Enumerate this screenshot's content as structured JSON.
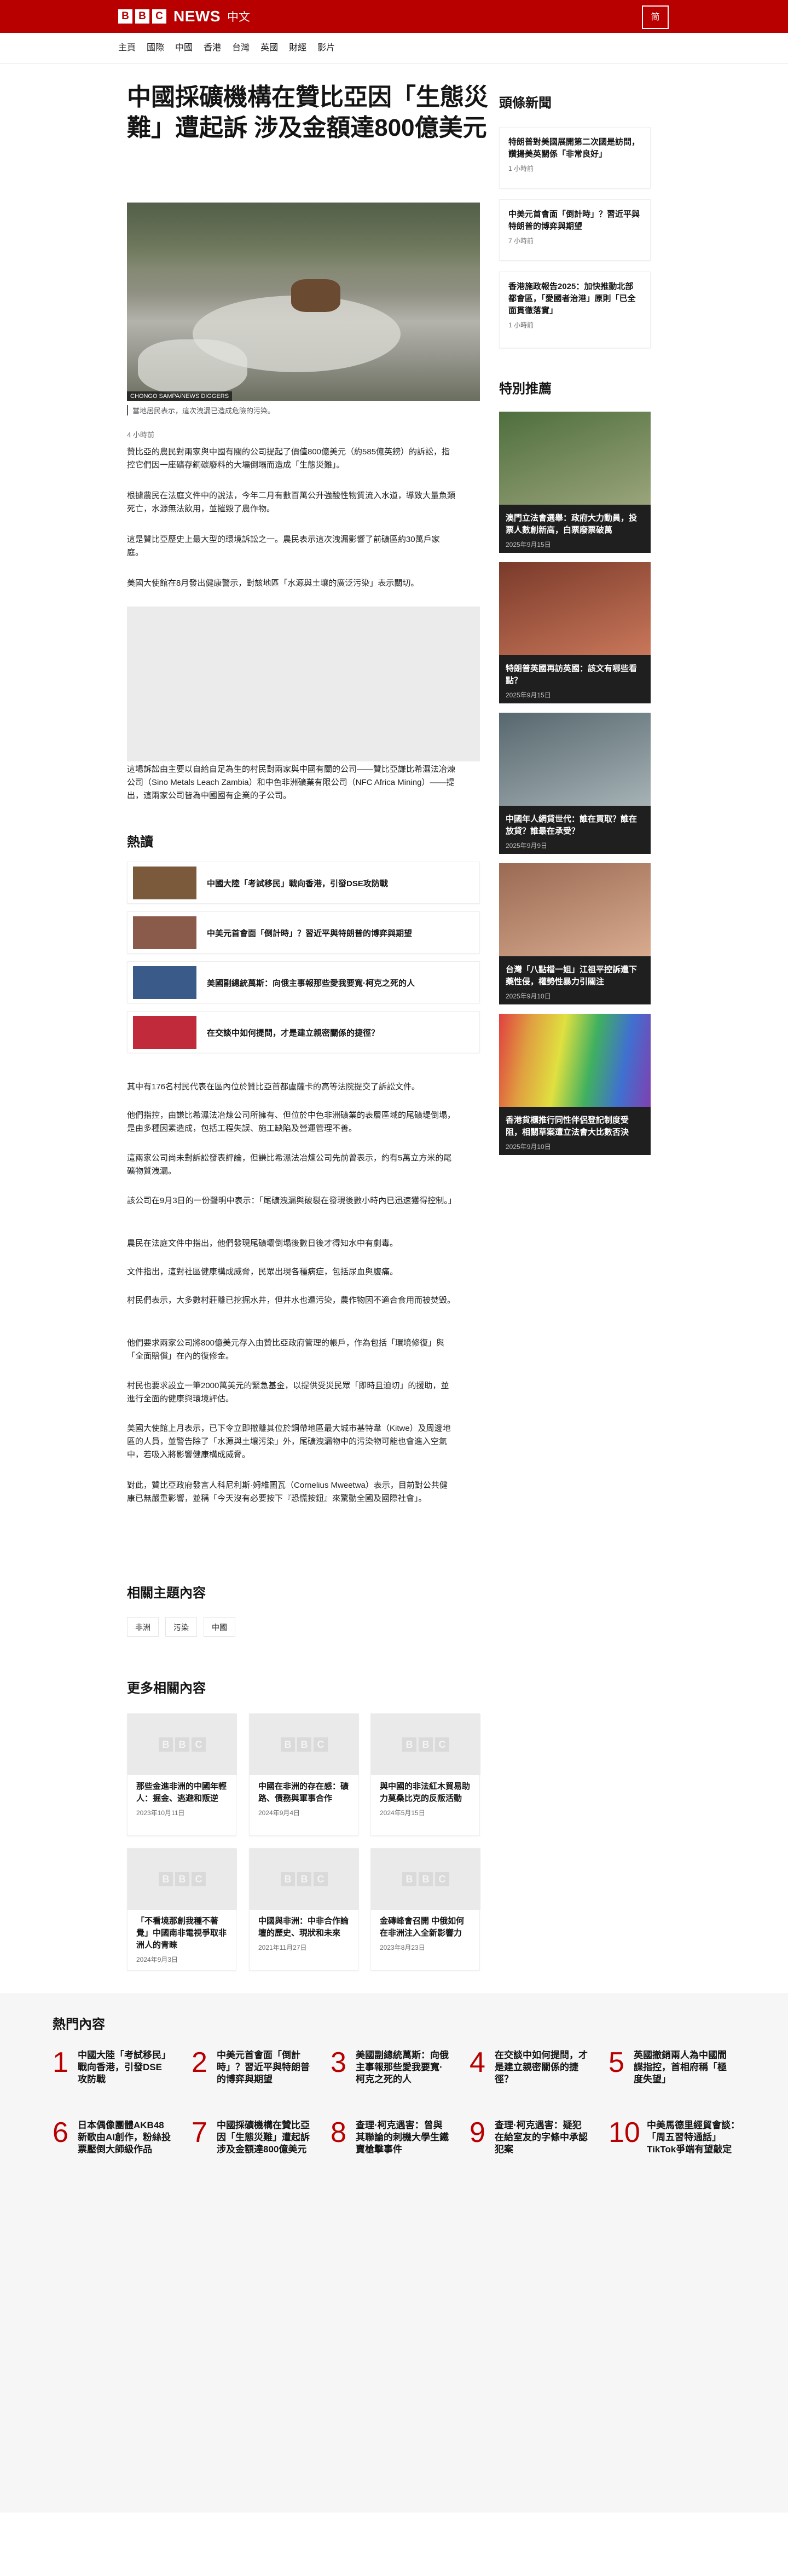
{
  "header": {
    "logo_letters": [
      "B",
      "B",
      "C"
    ],
    "brand": "NEWS",
    "language": "中文",
    "menu_label": "简"
  },
  "nav": [
    "主頁",
    "國際",
    "中國",
    "香港",
    "台灣",
    "英國",
    "財經",
    "影片"
  ],
  "article": {
    "headline": "中國採礦機構在贊比亞因「生態災難」遭起訴 涉及金額達800億美元",
    "image_credit": "CHONGO SAMPA/NEWS DIGGERS",
    "caption": "當地居民表示，這次洩漏已造成危險的污染。",
    "time_ago": "4 小時前",
    "paragraphs": [
      "贊比亞的農民對兩家與中國有關的公司提起了價值800億美元（約585億英鎊）的訴訟，指控它們因一座礦存銅碳廢料的大壩倒塌而造成「生態災難」。",
      "根據農民在法庭文件中的說法，今年二月有數百萬公升強酸性物質流入水道，導致大量魚類死亡，水源無法飲用，並摧毀了農作物。",
      "這是贊比亞歷史上最大型的環境訴訟之一。農民表示這次洩漏影響了前礦區約30萬戶家庭。",
      "美國大使館在8月發出健康警示，對該地區「水源與土壤的廣泛污染」表示關切。",
      "這場訴訟由主要以自給自足為生的村民對兩家與中國有關的公司——贊比亞謙比希濕法冶煉公司（Sino Metals Leach Zambia）和中色非洲礦業有限公司（NFC Africa Mining）——提出，這兩家公司皆為中國國有企業的子公司。"
    ],
    "more_paragraphs": [
      "其中有176名村民代表在區內位於贊比亞首都盧薩卡的高等法院提交了訴訟文件。",
      "他們指控，由謙比希濕法冶煉公司所擁有、但位於中色非洲礦業的表層區域的尾礦堤倒塌，是由多種因素造成，包括工程失誤、施工缺陷及營運管理不善。",
      "這兩家公司尚未對訴訟發表評論，但謙比希濕法冶煉公司先前曾表示，約有5萬立方米的尾礦物質洩漏。",
      "該公司在9月3日的一份聲明中表示：「尾礦洩漏與破裂在發現後數小時內已迅速獲得控制。」",
      "農民在法庭文件中指出，他們發現尾礦壩倒塌後數日後才得知水中有劇毒。",
      "文件指出，這對社區健康構成威脅，民眾出現各種病症，包括尿血與腹痛。",
      "村民們表示，大多數村莊離已挖掘水井，但井水也遭污染，農作物因不適合食用而被焚毀。",
      "他們要求兩家公司將800億美元存入由贊比亞政府管理的帳戶，作為包括「環境修復」與「全面賠償」在內的復修金。",
      "村民也要求設立一筆2000萬美元的緊急基金，以提供受災民眾「即時且迫切」的援助，並進行全面的健康與環境評估。",
      "美國大使館上月表示，已下令立即撤離其位於銅帶地區最大城市基特韋（Kitwe）及周邊地區的人員，並警告除了「水源與土壤污染」外，尾礦洩漏物中的污染物可能也會進入空氣中，若吸入將影響健康構成威脅。",
      "對此，贊比亞政府發言人科尼利斯·姆維圖瓦（Cornelius Mweetwa）表示，目前對公共健康已無嚴重影響，並稱「今天沒有必要按下『恐慌按鈕』來驚動全國及國際社會」。"
    ]
  },
  "sidebar": {
    "top_stories_title": "頭條新聞",
    "top_stories": [
      {
        "title": "特朗普對美國展開第二次國是訪問，讚揚美英關係「非常良好」",
        "time": "1 小時前"
      },
      {
        "title": "中美元首會面「倒計時」？習近平與特朗普的博弈與期望",
        "time": "7 小時前"
      },
      {
        "title": "香港施政報告2025：加快推動北部都會區，「愛國者治港」原則「已全面貫徹落實」",
        "time": "1 小時前"
      }
    ],
    "features_title": "特別推薦",
    "features": [
      {
        "title": "澳門立法會選舉：政府大力動員，投票人數創新高，白票廢票破萬",
        "date": "2025年9月15日",
        "color": "#5a7a4a"
      },
      {
        "title": "特朗普英國再訪英國：該文有哪些看點？",
        "date": "2025年9月15日",
        "color": "#9a5540"
      },
      {
        "title": "中國年人網貸世代：誰在買取？誰在放貸？誰最在承受？",
        "date": "2025年9月9日",
        "color": "#6f7f85"
      },
      {
        "title": "台灣「八點檔一姐」江祖平控訴遭下藥性侵，權勢性暴力引關注",
        "date": "2025年9月10日",
        "color": "#b5836a"
      },
      {
        "title": "香港貨櫃推行同性伴侶登記制度受阻，相關草案遭立法會大比數否決",
        "date": "2025年9月10日",
        "color": "#5b6b8f"
      }
    ]
  },
  "trending": {
    "title": "熱讀",
    "items": [
      {
        "title": "中國大陸「考試移民」戰向香港，引發DSE攻防戰",
        "color": "#7a5a3a"
      },
      {
        "title": "中美元首會面「倒計時」？習近平與特朗普的博弈與期望",
        "color": "#8a5a4a"
      },
      {
        "title": "美國副總統萬斯：向俄主事報那些愛我要寬·柯克之死的人",
        "color": "#3a5a8a"
      },
      {
        "title": "在交談中如何提問，才是建立親密關係的捷徑？",
        "color": "#c02a3a"
      }
    ]
  },
  "related_topics": {
    "title": "相關主題內容",
    "tags": [
      "非洲",
      "污染",
      "中國"
    ]
  },
  "more_content": {
    "title": "更多相關內容",
    "items": [
      {
        "title": "那些金進非洲的中國年輕人：掘金、逃避和叛逆",
        "date": "2023年10月11日"
      },
      {
        "title": "中國在非洲的存在感：礦路、債務與軍事合作",
        "date": "2024年9月4日"
      },
      {
        "title": "與中國的非法紅木貿易助力莫桑比克的反叛活動",
        "date": "2024年5月15日"
      },
      {
        "title": "「不看境那創我種不著覺」中國南非電視爭取非洲人的青睞",
        "date": "2024年9月3日"
      },
      {
        "title": "中國與非洲：中非合作論壇的歷史、現狀和未來",
        "date": "2021年11月27日"
      },
      {
        "title": "金磚峰會召開 中俄如何在非洲注入全新影響力",
        "date": "2023年8月23日"
      }
    ]
  },
  "most_read": {
    "title": "熱門內容",
    "items": [
      {
        "num": "1",
        "title": "中國大陸「考試移民」戰向香港，引發DSE攻防戰"
      },
      {
        "num": "2",
        "title": "中美元首會面「倒計時」？習近平與特朗普的博弈與期望"
      },
      {
        "num": "3",
        "title": "美國副總統萬斯：向俄主事報那些愛我要寬·柯克之死的人"
      },
      {
        "num": "4",
        "title": "在交談中如何提問，才是建立親密關係的捷徑？"
      },
      {
        "num": "5",
        "title": "英國撤銷兩人為中國間諜指控，首相府稱「極度失望」"
      },
      {
        "num": "6",
        "title": "日本偶像團體AKB48新歌由AI創作，粉絲投票壓倒大師級作品"
      },
      {
        "num": "7",
        "title": "中國採礦機構在贊比亞因「生態災難」遭起訴 涉及金額達800億美元"
      },
      {
        "num": "8",
        "title": "查理·柯克遇害：曾與其聯論的刺機大學生鐵賣槍擊事件"
      },
      {
        "num": "9",
        "title": "查理·柯克遇害：疑犯在給室友的字條中承認犯案"
      },
      {
        "num": "10",
        "title": "中美馬德里經貿會談：「周五習特通話」TikTok爭端有望敲定"
      }
    ]
  }
}
